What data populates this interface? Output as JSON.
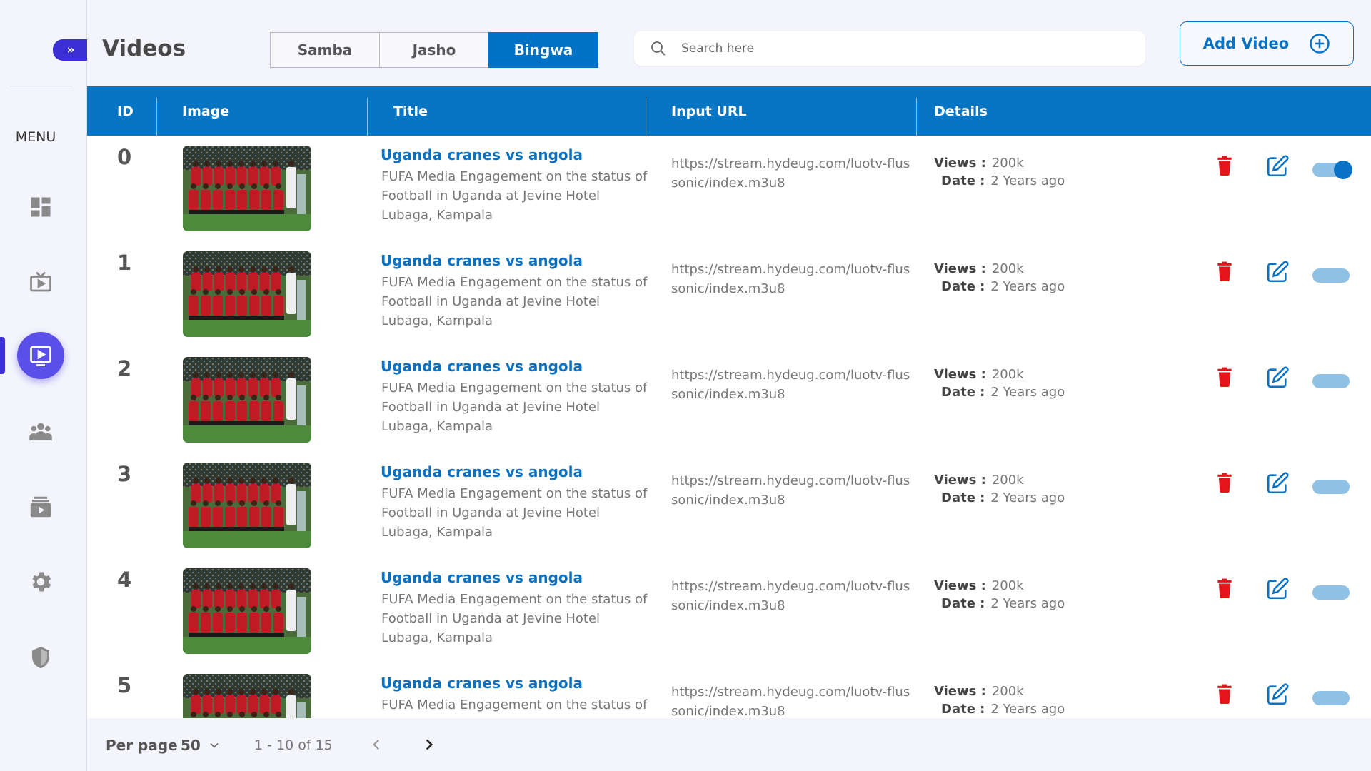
{
  "sidebar": {
    "toggle_glyph": "»",
    "menu_label": "MENU",
    "items": [
      {
        "icon": "dashboard-icon",
        "active": false
      },
      {
        "icon": "tv-icon",
        "active": false
      },
      {
        "icon": "video-play-icon",
        "active": true
      },
      {
        "icon": "users-icon",
        "active": false
      },
      {
        "icon": "video-library-icon",
        "active": false
      },
      {
        "icon": "gear-icon",
        "active": false
      },
      {
        "icon": "shield-icon",
        "active": false
      }
    ]
  },
  "header": {
    "title": "Videos",
    "tabs": [
      {
        "label": "Samba",
        "active": false
      },
      {
        "label": "Jasho",
        "active": false
      },
      {
        "label": "Bingwa",
        "active": true
      }
    ],
    "search_placeholder": "Search here",
    "add_button_label": "Add Video"
  },
  "table": {
    "columns": [
      "ID",
      "Image",
      "Title",
      "Input URL",
      "Details"
    ],
    "views_label": "Views :",
    "date_label": "Date :",
    "rows": [
      {
        "id": "0",
        "title": "Uganda cranes vs angola",
        "description": "FUFA Media Engagement on the status of Football in Uganda at Jevine Hotel Lubaga, Kampala",
        "url": "https://stream.hydeug.com/luotv-flussonic/index.m3u8",
        "views": "200k",
        "date": "2 Years ago",
        "enabled": true
      },
      {
        "id": "1",
        "title": "Uganda cranes vs angola",
        "description": "FUFA Media Engagement on the status of Football in Uganda at Jevine Hotel Lubaga, Kampala",
        "url": "https://stream.hydeug.com/luotv-flussonic/index.m3u8",
        "views": "200k",
        "date": "2 Years ago",
        "enabled": false
      },
      {
        "id": "2",
        "title": "Uganda cranes vs angola",
        "description": "FUFA Media Engagement on the status of Football in Uganda at Jevine Hotel Lubaga, Kampala",
        "url": "https://stream.hydeug.com/luotv-flussonic/index.m3u8",
        "views": "200k",
        "date": "2 Years ago",
        "enabled": false
      },
      {
        "id": "3",
        "title": "Uganda cranes vs angola",
        "description": "FUFA Media Engagement on the status of Football in Uganda at Jevine Hotel Lubaga, Kampala",
        "url": "https://stream.hydeug.com/luotv-flussonic/index.m3u8",
        "views": "200k",
        "date": "2 Years ago",
        "enabled": false
      },
      {
        "id": "4",
        "title": "Uganda cranes vs angola",
        "description": "FUFA Media Engagement on the status of Football in Uganda at Jevine Hotel Lubaga, Kampala",
        "url": "https://stream.hydeug.com/luotv-flussonic/index.m3u8",
        "views": "200k",
        "date": "2 Years ago",
        "enabled": false
      },
      {
        "id": "5",
        "title": "Uganda cranes vs angola",
        "description": "FUFA Media Engagement on the status of Football in Uganda at Jevine Hotel Lubaga, Kampala",
        "url": "https://stream.hydeug.com/luotv-flussonic/index.m3u8",
        "views": "200k",
        "date": "2 Years ago",
        "enabled": false
      }
    ]
  },
  "footer": {
    "per_page_label": "Per page",
    "per_page_value": "50",
    "range_text": "1 - 10 of 15"
  },
  "colors": {
    "accent": "#0072c6",
    "sidebar_active": "#5a4fe8",
    "delete": "#e8141c"
  }
}
